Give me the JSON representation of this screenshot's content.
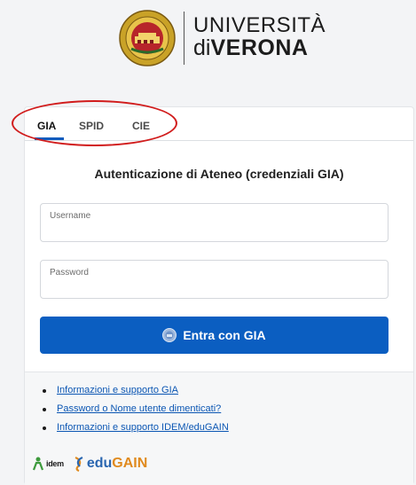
{
  "header": {
    "brand_line1": "UNIVERSITÀ",
    "brand_line2_prefix": "di",
    "brand_line2_name": "VERONA"
  },
  "tabs": [
    {
      "label": "GIA",
      "active": true
    },
    {
      "label": "SPID",
      "active": false
    },
    {
      "label": "CIE",
      "active": false
    }
  ],
  "form": {
    "title": "Autenticazione di Ateneo (credenziali GIA)",
    "username_label": "Username",
    "username_value": "",
    "password_label": "Password",
    "password_value": "",
    "submit_label": "Entra con GIA"
  },
  "links": [
    "Informazioni e supporto GIA",
    "Password o Nome utente dimenticati?",
    "Informazioni e supporto IDEM/eduGAIN"
  ],
  "logos": {
    "idem_word": "idem",
    "edugain_prefix": "edu",
    "edugain_suffix": "GAIN"
  },
  "colors": {
    "accent": "#0b5ec1",
    "highlight_circle": "#d11c1c",
    "link": "#0b56b3"
  }
}
